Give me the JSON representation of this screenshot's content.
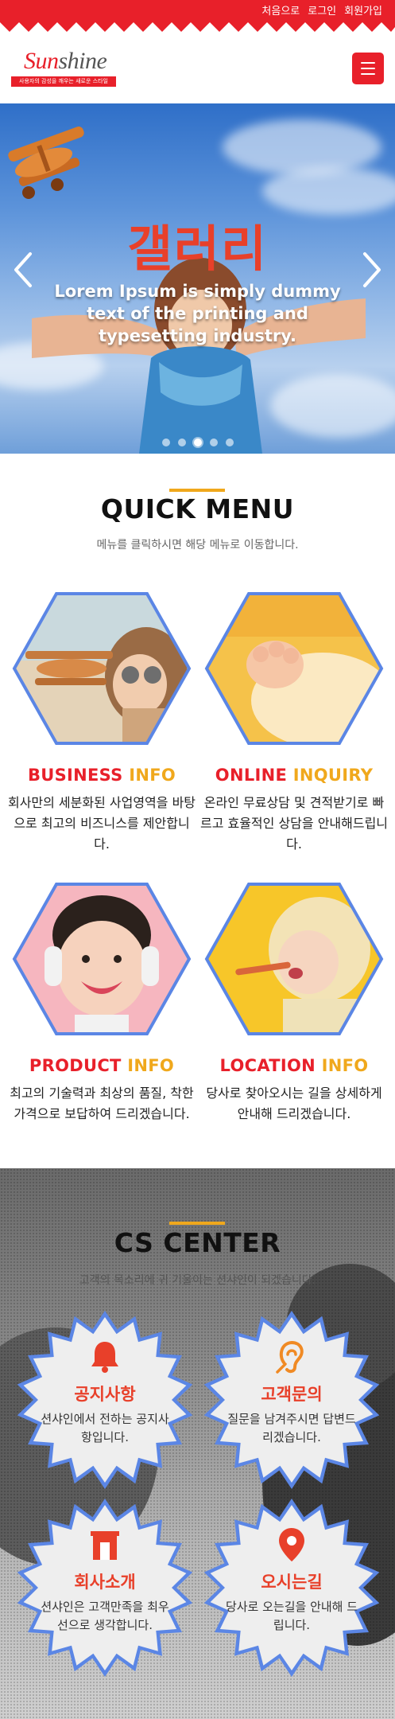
{
  "topbar": {
    "links": [
      "처음으로",
      "로그인",
      "회원가입"
    ]
  },
  "header": {
    "logo_first": "Sun",
    "logo_rest": "shine",
    "logo_tagline": "사용자의 감성을 깨우는 새로운 스타일",
    "menu_icon": "hamburger-icon"
  },
  "hero": {
    "title": "갤러리",
    "subtitle": "Lorem Ipsum is simply dummy text of the printing and typesetting industry.",
    "slide_count": 5,
    "active_slide": 3
  },
  "quick_menu": {
    "title": "QUICK MENU",
    "desc": "메뉴를 클릭하시면 해당 메뉴로 이동합니다.",
    "cards": [
      {
        "title_main": "BUSINESS",
        "title_accent": "INFO",
        "desc": "회사만의 세분화된 사업영역을 바탕으로 최고의 비즈니스를 제안합니다."
      },
      {
        "title_main": "ONLINE",
        "title_accent": "INQUIRY",
        "desc": "온라인 무료상담 및 견적받기로 빠르고 효율적인 상담을 안내해드립니다."
      },
      {
        "title_main": "PRODUCT",
        "title_accent": "INFO",
        "desc": "최고의 기술력과 최상의 품질, 착한 가격으로 보답하여 드리겠습니다."
      },
      {
        "title_main": "LOCATION",
        "title_accent": "INFO",
        "desc": "당사로 찾아오시는 길을 상세하게 안내해 드리겠습니다."
      }
    ]
  },
  "cs_center": {
    "title": "CS CENTER",
    "desc": "고객의 목소리에 귀 기울이는 션샤인이 되겠습니다.",
    "items": [
      {
        "icon": "bell-icon",
        "title": "공지사항",
        "desc": "션샤인에서 전하는 공지사항입니다."
      },
      {
        "icon": "hearing-icon",
        "title": "고객문의",
        "desc": "질문을 남겨주시면 답변드리겠습니다."
      },
      {
        "icon": "building-icon",
        "title": "회사소개",
        "desc": "션샤인은 고객만족을 최우선으로 생각합니다."
      },
      {
        "icon": "map-pin-icon",
        "title": "오시는길",
        "desc": "당사로 오는길을 안내해 드립니다."
      }
    ]
  },
  "colors": {
    "brand_red": "#e8202a",
    "accent_orange": "#f0a81c",
    "hex_border": "#5b86e5"
  }
}
